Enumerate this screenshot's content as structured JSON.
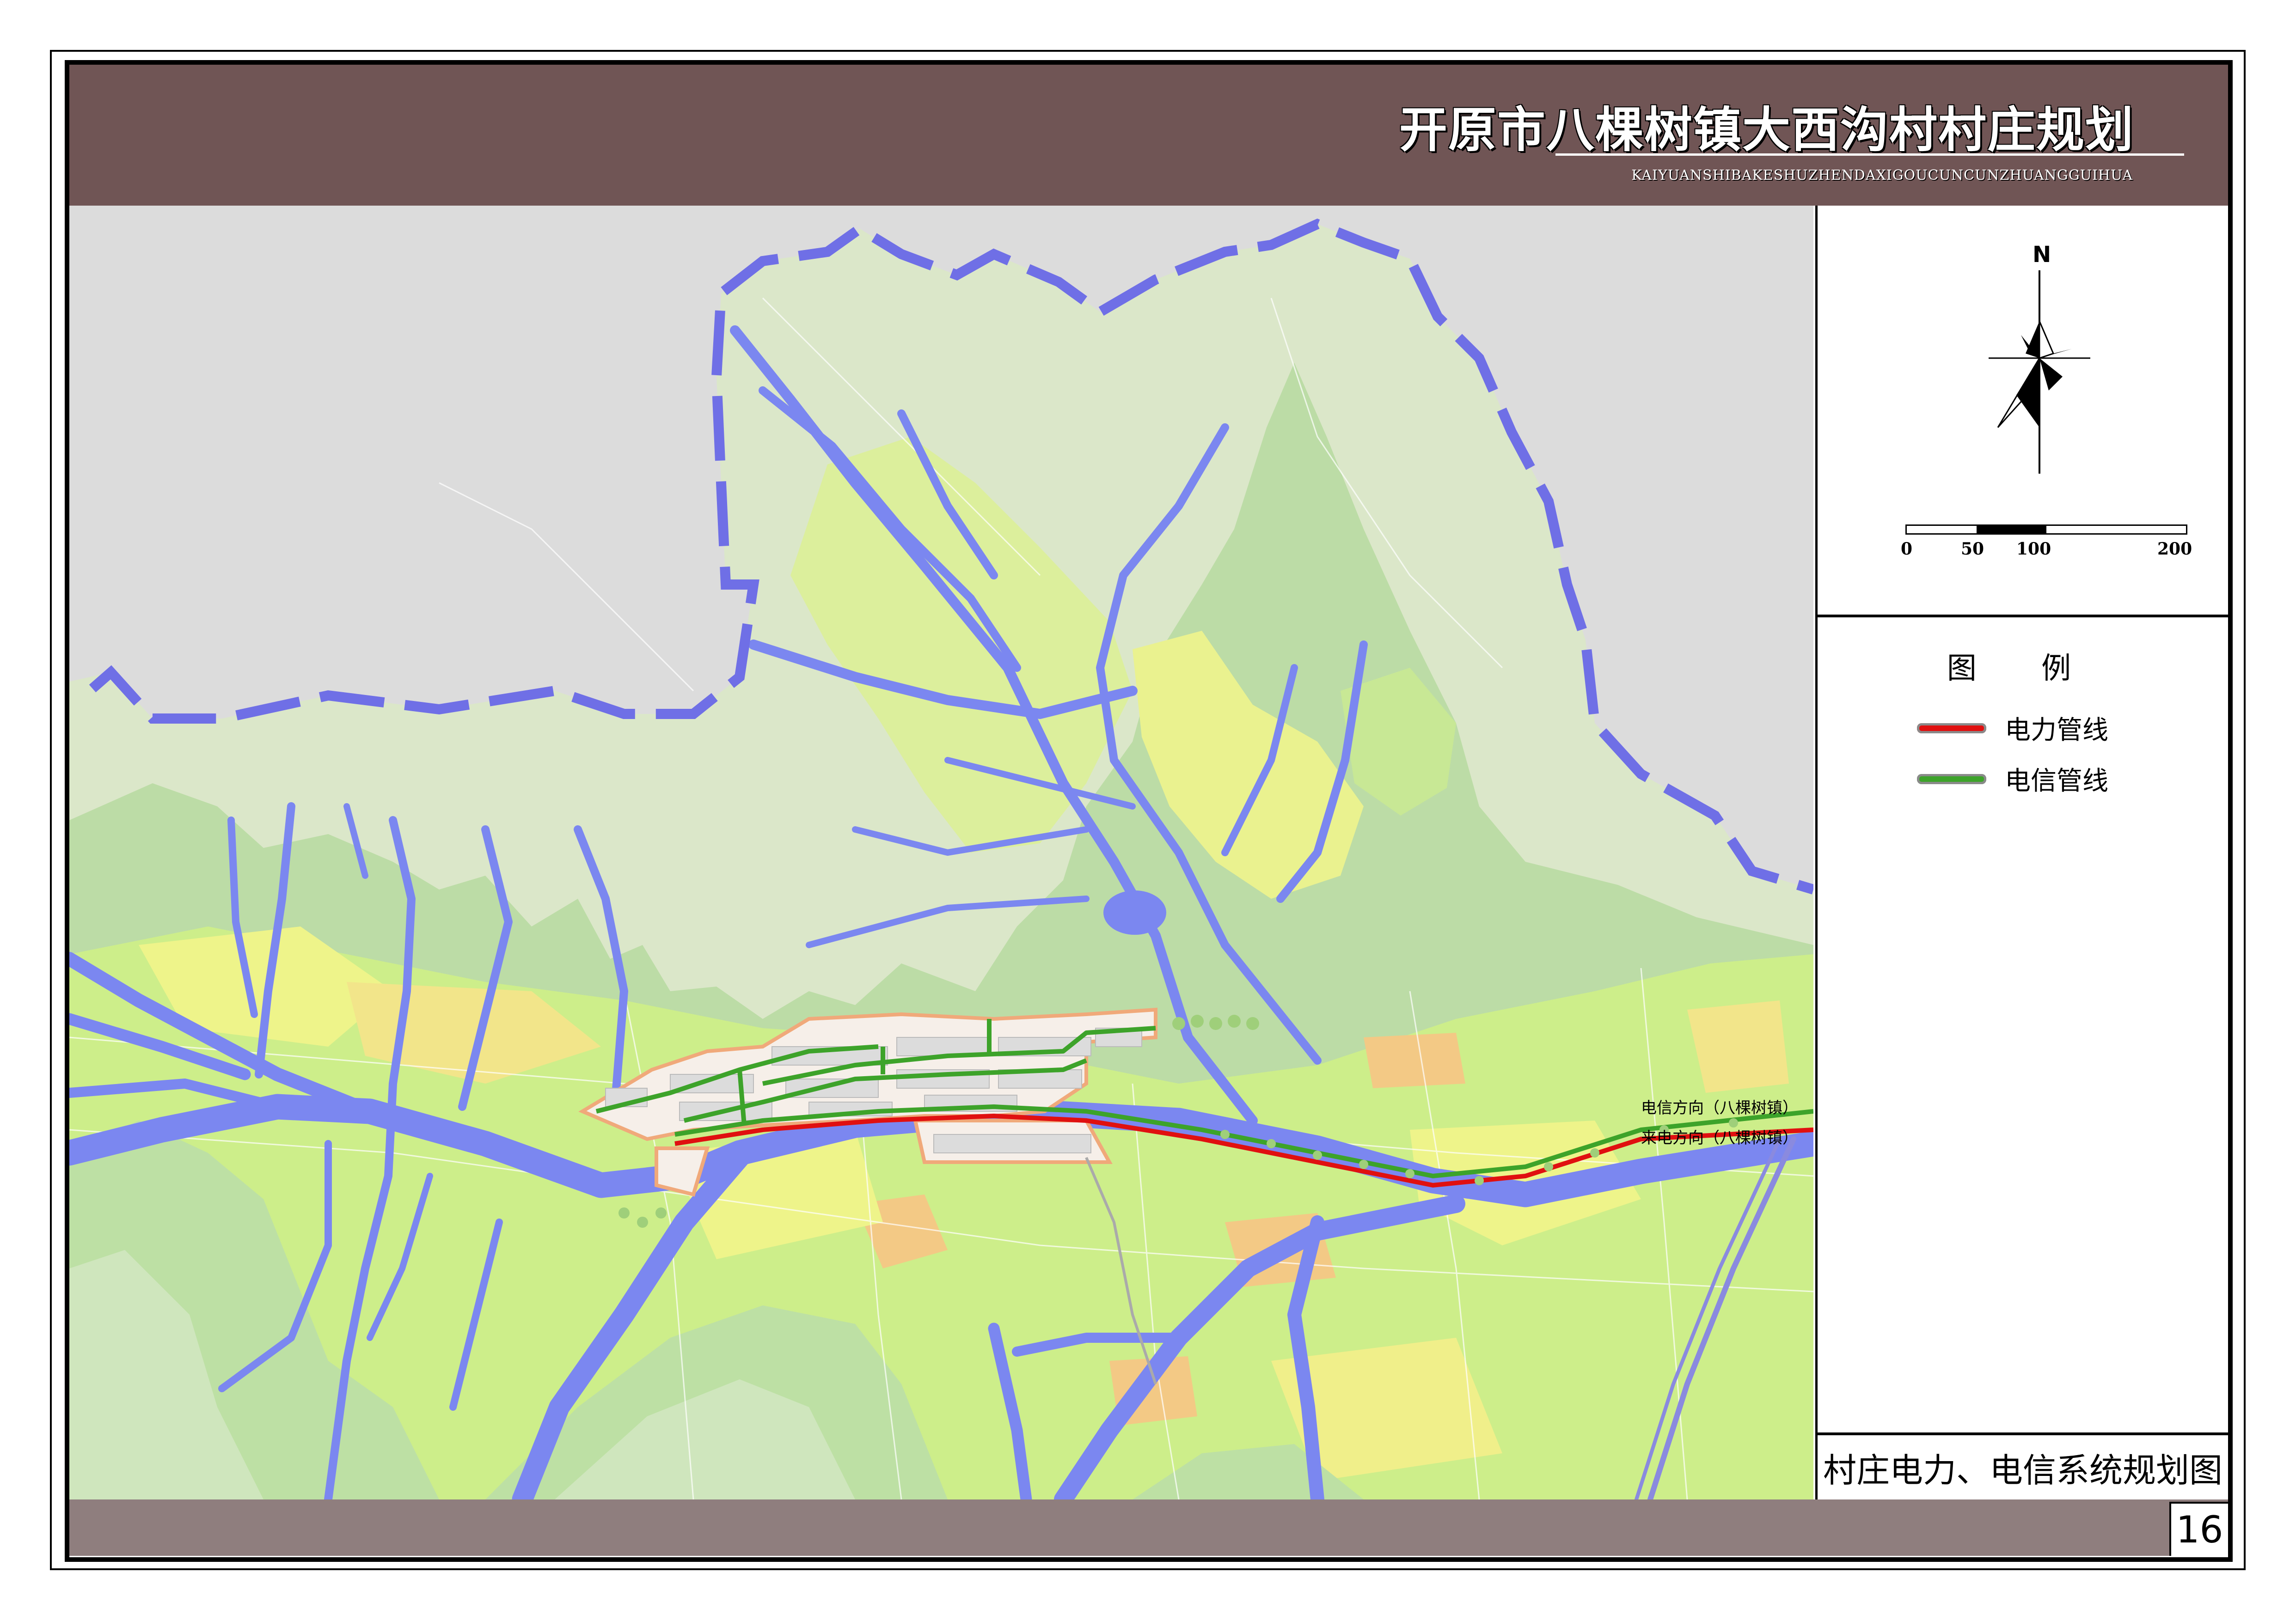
{
  "header": {
    "title": "开原市八棵树镇大西沟村村庄规划",
    "subtitle": "KAIYUANSHIBAKESHUZHENDAXIGOUCUNCUNZHUANGGUIHUA"
  },
  "compass": {
    "north_label": "N"
  },
  "scale_bar": {
    "ticks": [
      "0",
      "50",
      "100",
      "200"
    ]
  },
  "legend": {
    "title": "图 例",
    "items": [
      {
        "label": "电力管线",
        "color": "#e01010"
      },
      {
        "label": "电信管线",
        "color": "#3da32a"
      }
    ]
  },
  "map": {
    "labels": {
      "telecom_direction": "电信方向（八棵树镇）",
      "power_direction": "来电方向（八棵树镇）"
    },
    "colors": {
      "water": "#7b87f0",
      "boundary": "#6f6fe6",
      "power_line": "#e01010",
      "telecom_line": "#3da32a",
      "outside_area": "#dcdcdc"
    }
  },
  "plan_title": "村庄电力、电信系统规划图",
  "page_number": "16"
}
